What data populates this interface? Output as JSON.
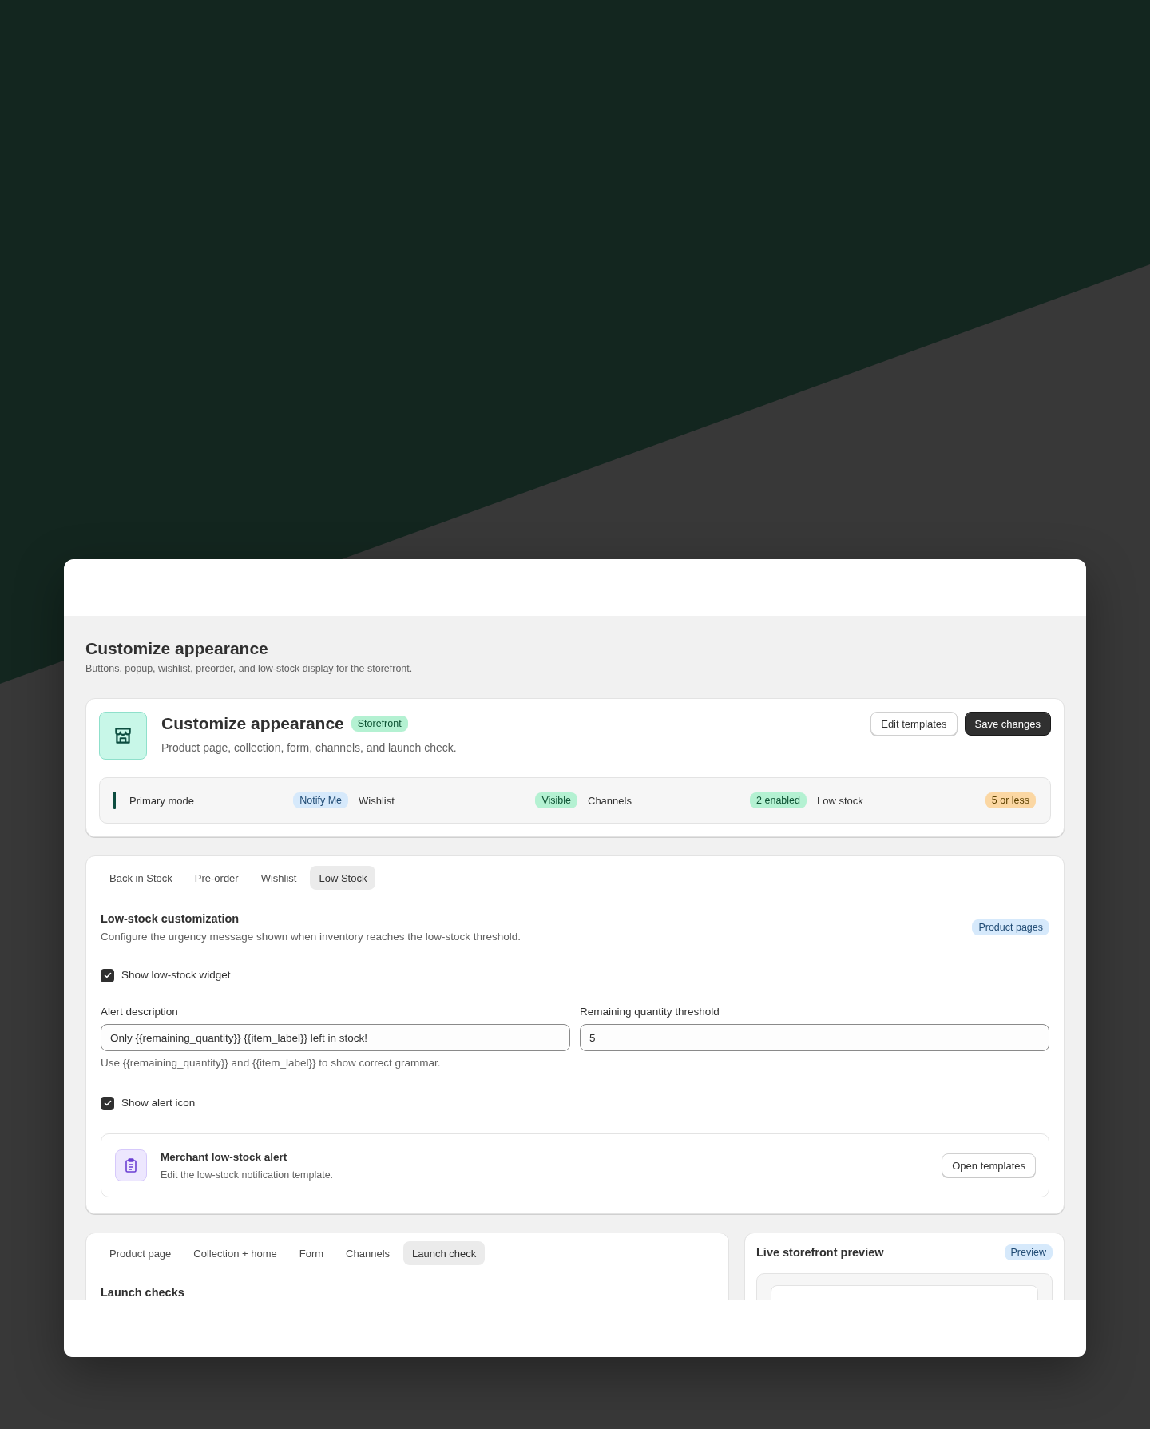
{
  "page": {
    "title": "Customize appearance",
    "subtitle": "Buttons, popup, wishlist, preorder, and low-stock display for the storefront."
  },
  "summary": {
    "title": "Customize appearance",
    "badge": "Storefront",
    "subtitle": "Product page, collection, form, channels, and launch check.",
    "buttons": [
      {
        "label": "Edit templates",
        "kind": "secondary"
      },
      {
        "label": "Save changes",
        "kind": "primary"
      }
    ],
    "stats": [
      {
        "label": "Primary mode",
        "value": "Notify Me",
        "color": "#d6e9fb"
      },
      {
        "label": "Wishlist",
        "value": "Visible",
        "color": "#b4f1d2"
      },
      {
        "label": "Channels",
        "value": "2 enabled",
        "color": "#b4f1d2"
      },
      {
        "label": "Low stock",
        "value": "5 or less",
        "color": "#fbd7a3"
      }
    ]
  },
  "settings": {
    "tabs": [
      {
        "label": "Back in Stock",
        "selected": false
      },
      {
        "label": "Pre-order",
        "selected": false
      },
      {
        "label": "Wishlist",
        "selected": false
      },
      {
        "label": "Low Stock",
        "selected": true
      }
    ],
    "title": "Low-stock customization",
    "description": "Configure the urgency message shown when inventory reaches the low-stock threshold.",
    "badge": "Product pages",
    "show_widget": {
      "label": "Show low-stock widget",
      "checked": true
    },
    "fields": [
      {
        "label": "Alert description",
        "value": "Only {{remaining_quantity}} {{item_label}} left in stock!"
      },
      {
        "label": "Remaining quantity threshold",
        "value": "5"
      }
    ],
    "hint": "Use {{remaining_quantity}} and {{item_label}} to show correct grammar.",
    "show_icon": {
      "label": "Show alert icon",
      "checked": true
    },
    "alert_card": {
      "title": "Merchant low-stock alert",
      "description": "Edit the low-stock notification template.",
      "button": "Open templates"
    }
  },
  "launch": {
    "tabs": [
      {
        "label": "Product page",
        "selected": false
      },
      {
        "label": "Collection + home",
        "selected": false
      },
      {
        "label": "Form",
        "selected": false
      },
      {
        "label": "Channels",
        "selected": false
      },
      {
        "label": "Launch check",
        "selected": true
      }
    ],
    "heading": "Launch checks"
  },
  "preview": {
    "title": "Live storefront preview",
    "badge": "Preview"
  }
}
